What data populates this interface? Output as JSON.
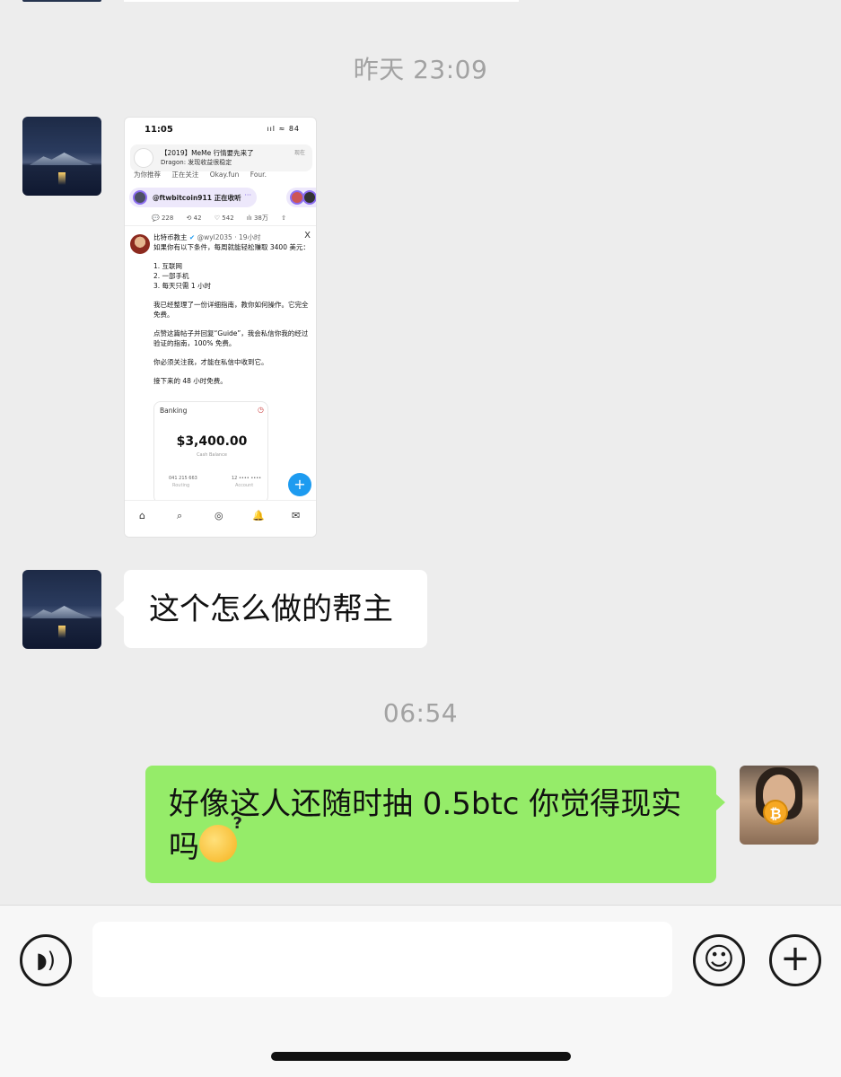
{
  "timestamps": {
    "t1": "昨天 23:09",
    "t2": "06:54"
  },
  "screenshot": {
    "status_time": "11:05",
    "status_icons": "ııl ≈ 84",
    "notification": {
      "title": "【2019】MeMe 行情要先来了",
      "subtitle": "Dragon: 发现收益很稳定",
      "time": "现在"
    },
    "tabs": [
      "为你推荐",
      "正在关注",
      "Okay.fun",
      "Four."
    ],
    "live": {
      "text": "@ftwbitcoin911 正在收听",
      "dots": "···"
    },
    "stats": [
      "💬 228",
      "⟲ 42",
      "♡ 542",
      "ılı 38万",
      "⇧"
    ],
    "author": {
      "name": "比特币教主",
      "handle": "@wyl2035 · 19小时"
    },
    "x_mark": "X",
    "body": [
      "如果你有以下条件，每周就能轻松赚取 3400 美元：",
      "1. 互联网\n2. 一部手机\n3. 每天只需 1 小时",
      "我已经整理了一份详细指南，教你如何操作。它完全免费。",
      "点赞这篇帖子并回复“Guide”，我会私信你我的经过验证的指南，100% 免费。",
      "你必须关注我，才能在私信中收到它。",
      "接下来的 48 小时免费。"
    ],
    "card": {
      "title": "Banking",
      "amount": "$3,400.00",
      "caption": "Cash Balance",
      "routing": "041 215 663",
      "routing_label": "Routing",
      "account": "12 •••• ••••",
      "account_label": "Account"
    },
    "fab": "+",
    "nav_icons": [
      "⌂",
      "⌕",
      "◎",
      "🔔",
      "✉"
    ]
  },
  "messages": {
    "m1": "这个怎么做的帮主",
    "m2": "好像这人还随时抽 0.5btc 你觉得现实吗"
  },
  "avatar_coin": "₿",
  "input": {
    "voice_icon": "◗)",
    "emoji_icon": "☺",
    "plus_icon": "+",
    "placeholder": ""
  }
}
